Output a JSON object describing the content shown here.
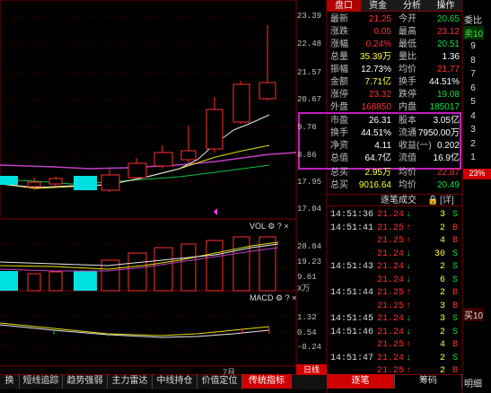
{
  "price_axis": [
    "23.39",
    "22.48",
    "21.57",
    "20.67",
    "9.76",
    "8.86",
    "17.95",
    "17.04"
  ],
  "vol_panel": {
    "title": "VOL",
    "axis": [
      "28.84",
      "19.23",
      "9.61",
      "X万"
    ]
  },
  "macd_panel": {
    "title": "MACD",
    "axis": [
      "1.32",
      "0.54",
      "-0.24"
    ]
  },
  "month_label": "7月",
  "tabs": [
    "盘口",
    "资金",
    "分析",
    "操作"
  ],
  "quote": [
    {
      "l1": "最新",
      "v1": "21.25",
      "l2": "今开",
      "v2": "20.65"
    },
    {
      "l1": "涨跌",
      "v1": "0.05",
      "l2": "最高",
      "v2": "23.12"
    },
    {
      "l1": "涨幅",
      "v1": "0.24%",
      "l2": "最低",
      "v2": "20.51"
    },
    {
      "l1": "总量",
      "v1": "35.39万",
      "l2": "量比",
      "v2": "1.36"
    },
    {
      "l1": "振幅",
      "v1": "12.73%",
      "l2": "均价",
      "v2": "21.77"
    },
    {
      "l1": "金额",
      "v1": "7.71亿",
      "l2": "换手",
      "v2": "44.51%"
    },
    {
      "l1": "涨停",
      "v1": "23.32",
      "l2": "跌停",
      "v2": "19.08"
    },
    {
      "l1": "外盘",
      "v1": "168850",
      "l2": "内盘",
      "v2": "185017"
    }
  ],
  "fund": [
    {
      "l1": "市盈",
      "v1": "26.31",
      "l2": "股本",
      "v2": "3.05亿"
    },
    {
      "l1": "换手",
      "v1": "44.51%",
      "l2": "流通",
      "v2": "7950.00万"
    },
    {
      "l1": "净资",
      "v1": "4.11",
      "l2": "收益(一)",
      "v2": "0.202"
    },
    {
      "l1": "总值",
      "v1": "64.7亿",
      "l2": "流值",
      "v2": "16.9亿"
    }
  ],
  "orders": [
    {
      "l1": "总买",
      "v1": "2.95万",
      "l2": "均价",
      "v2": "22.87"
    },
    {
      "l1": "总买",
      "v1": "9016.64",
      "l2": "均价",
      "v2": "20.49"
    }
  ],
  "ticks_header": {
    "title": "逐笔成交",
    "detail": "[详]"
  },
  "ticks": [
    {
      "t": "14:51:36",
      "p": "21.24",
      "d": "↓",
      "n": "3",
      "s": "S"
    },
    {
      "t": "14:51:41",
      "p": "21.25",
      "d": "↑",
      "n": "2",
      "s": "B"
    },
    {
      "t": "",
      "p": "21.25",
      "d": "↑",
      "n": "4",
      "s": "B"
    },
    {
      "t": "",
      "p": "21.24",
      "d": "↓",
      "n": "30",
      "s": "S"
    },
    {
      "t": "14:51:43",
      "p": "21.24",
      "d": "↓",
      "n": "2",
      "s": "S"
    },
    {
      "t": "",
      "p": "21.24",
      "d": "↓",
      "n": "6",
      "s": "S"
    },
    {
      "t": "14:51:44",
      "p": "21.25",
      "d": "↑",
      "n": "2",
      "s": "B"
    },
    {
      "t": "",
      "p": "21.25",
      "d": "↑",
      "n": "3",
      "s": "B"
    },
    {
      "t": "14:51:45",
      "p": "21.24",
      "d": "↓",
      "n": "3",
      "s": "S"
    },
    {
      "t": "14:51:46",
      "p": "21.24",
      "d": "↓",
      "n": "2",
      "s": "S"
    },
    {
      "t": "",
      "p": "21.25",
      "d": "↑",
      "n": "4",
      "s": "B"
    },
    {
      "t": "14:51:47",
      "p": "21.24",
      "d": "↓",
      "n": "2",
      "s": "S"
    },
    {
      "t": "",
      "p": "21.25",
      "d": "↑",
      "n": "2",
      "s": "B"
    }
  ],
  "right_strip": {
    "top": "委比",
    "sell": "卖10",
    "nums": [
      "9",
      "8",
      "7",
      "6",
      "5",
      "4",
      "3",
      "2",
      "1"
    ],
    "pct": "23%",
    "buy": "买10",
    "bottom": "明细"
  },
  "indicator_tabs": [
    "换",
    "短线追踪",
    "趋势强弱",
    "主力雷达",
    "中线持仓",
    "价值定位",
    "传统指标",
    "日线"
  ],
  "bottom_tabs": [
    "逐笔",
    "筹码"
  ]
}
